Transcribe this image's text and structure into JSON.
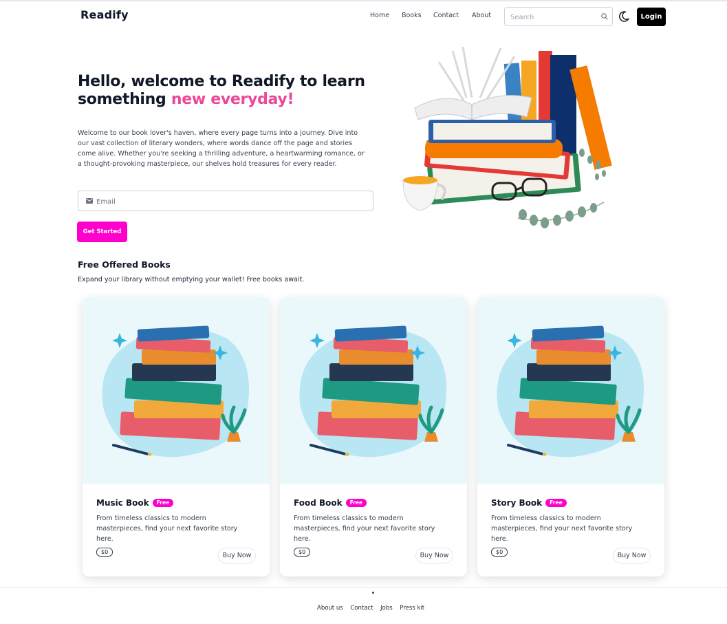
{
  "brand": "Readify",
  "nav": {
    "links": [
      "Home",
      "Books",
      "Contact",
      "About"
    ],
    "search_placeholder": "Search",
    "login_label": "Login"
  },
  "hero": {
    "title_main": "Hello, welcome to Readify to learn something ",
    "title_accent": "new everyday!",
    "description": "Welcome to our book lover's haven, where every page turns into a journey. Dive into our vast collection of literary wonders, where words dance off the page and stories come alive. Whether you're seeking a thrilling adventure, a heartwarming romance, or a thought-provoking masterpiece, our shelves hold treasures for every reader.",
    "email_placeholder": "Email",
    "cta_label": "Get Started"
  },
  "free_section": {
    "title": "Free Offered Books",
    "subtitle": "Expand your library without emptying your wallet! Free books await."
  },
  "cards": [
    {
      "title": "Music Book",
      "badge": "Free",
      "description": "From timeless classics to modern masterpieces, find your next favorite story here.",
      "price": "$0",
      "button": "Buy Now"
    },
    {
      "title": "Food Book",
      "badge": "Free",
      "description": "From timeless classics to modern masterpieces, find your next favorite story here.",
      "price": "$0",
      "button": "Buy Now"
    },
    {
      "title": "Story Book",
      "badge": "Free",
      "description": "From timeless classics to modern masterpieces, find your next favorite story here.",
      "price": "$0",
      "button": "Buy Now"
    }
  ],
  "footer": {
    "links": [
      "About us",
      "Contact",
      "Jobs",
      "Press kit"
    ]
  },
  "colors": {
    "accent_pink": "#ec4899",
    "cta_magenta": "#ff00cc",
    "login_black": "#000000"
  },
  "icons": {
    "search": "search-icon",
    "theme_toggle": "moon-icon",
    "email": "envelope-icon"
  }
}
